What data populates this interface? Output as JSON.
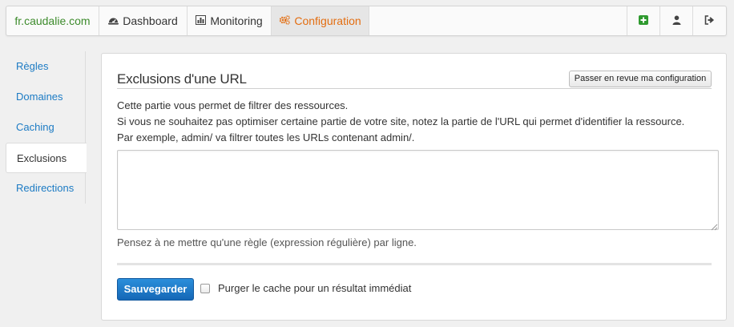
{
  "nav": {
    "brand": "fr.caudalie.com",
    "dashboard": "Dashboard",
    "monitoring": "Monitoring",
    "configuration": "Configuration"
  },
  "sidebar": {
    "items": [
      {
        "label": "Règles"
      },
      {
        "label": "Domaines"
      },
      {
        "label": "Caching"
      },
      {
        "label": "Exclusions"
      },
      {
        "label": "Redirections"
      }
    ],
    "active": "Exclusions"
  },
  "main": {
    "title": "Exclusions d'une URL",
    "review_button": "Passer en revue ma configuration",
    "description": [
      "Cette partie vous permet de filtrer des ressources.",
      "Si vous ne souhaitez pas optimiser certaine partie de votre site, notez la partie de l'URL qui permet d'identifier la ressource.",
      "Par exemple, admin/ va filtrer toutes les URLs contenant admin/."
    ],
    "rules_value": "",
    "hint": "Pensez à ne mettre qu'une règle (expression régulière) par ligne.",
    "save_button": "Sauvegarder",
    "purge_label": "Purger le cache pour un résultat immédiat",
    "purge_checked": false
  },
  "colors": {
    "brand": "#3d8b2c",
    "link": "#1c7bc4",
    "active_tab": "#e36d10",
    "primary_button": "#1a78c8",
    "add_icon": "#2f9a2f"
  }
}
